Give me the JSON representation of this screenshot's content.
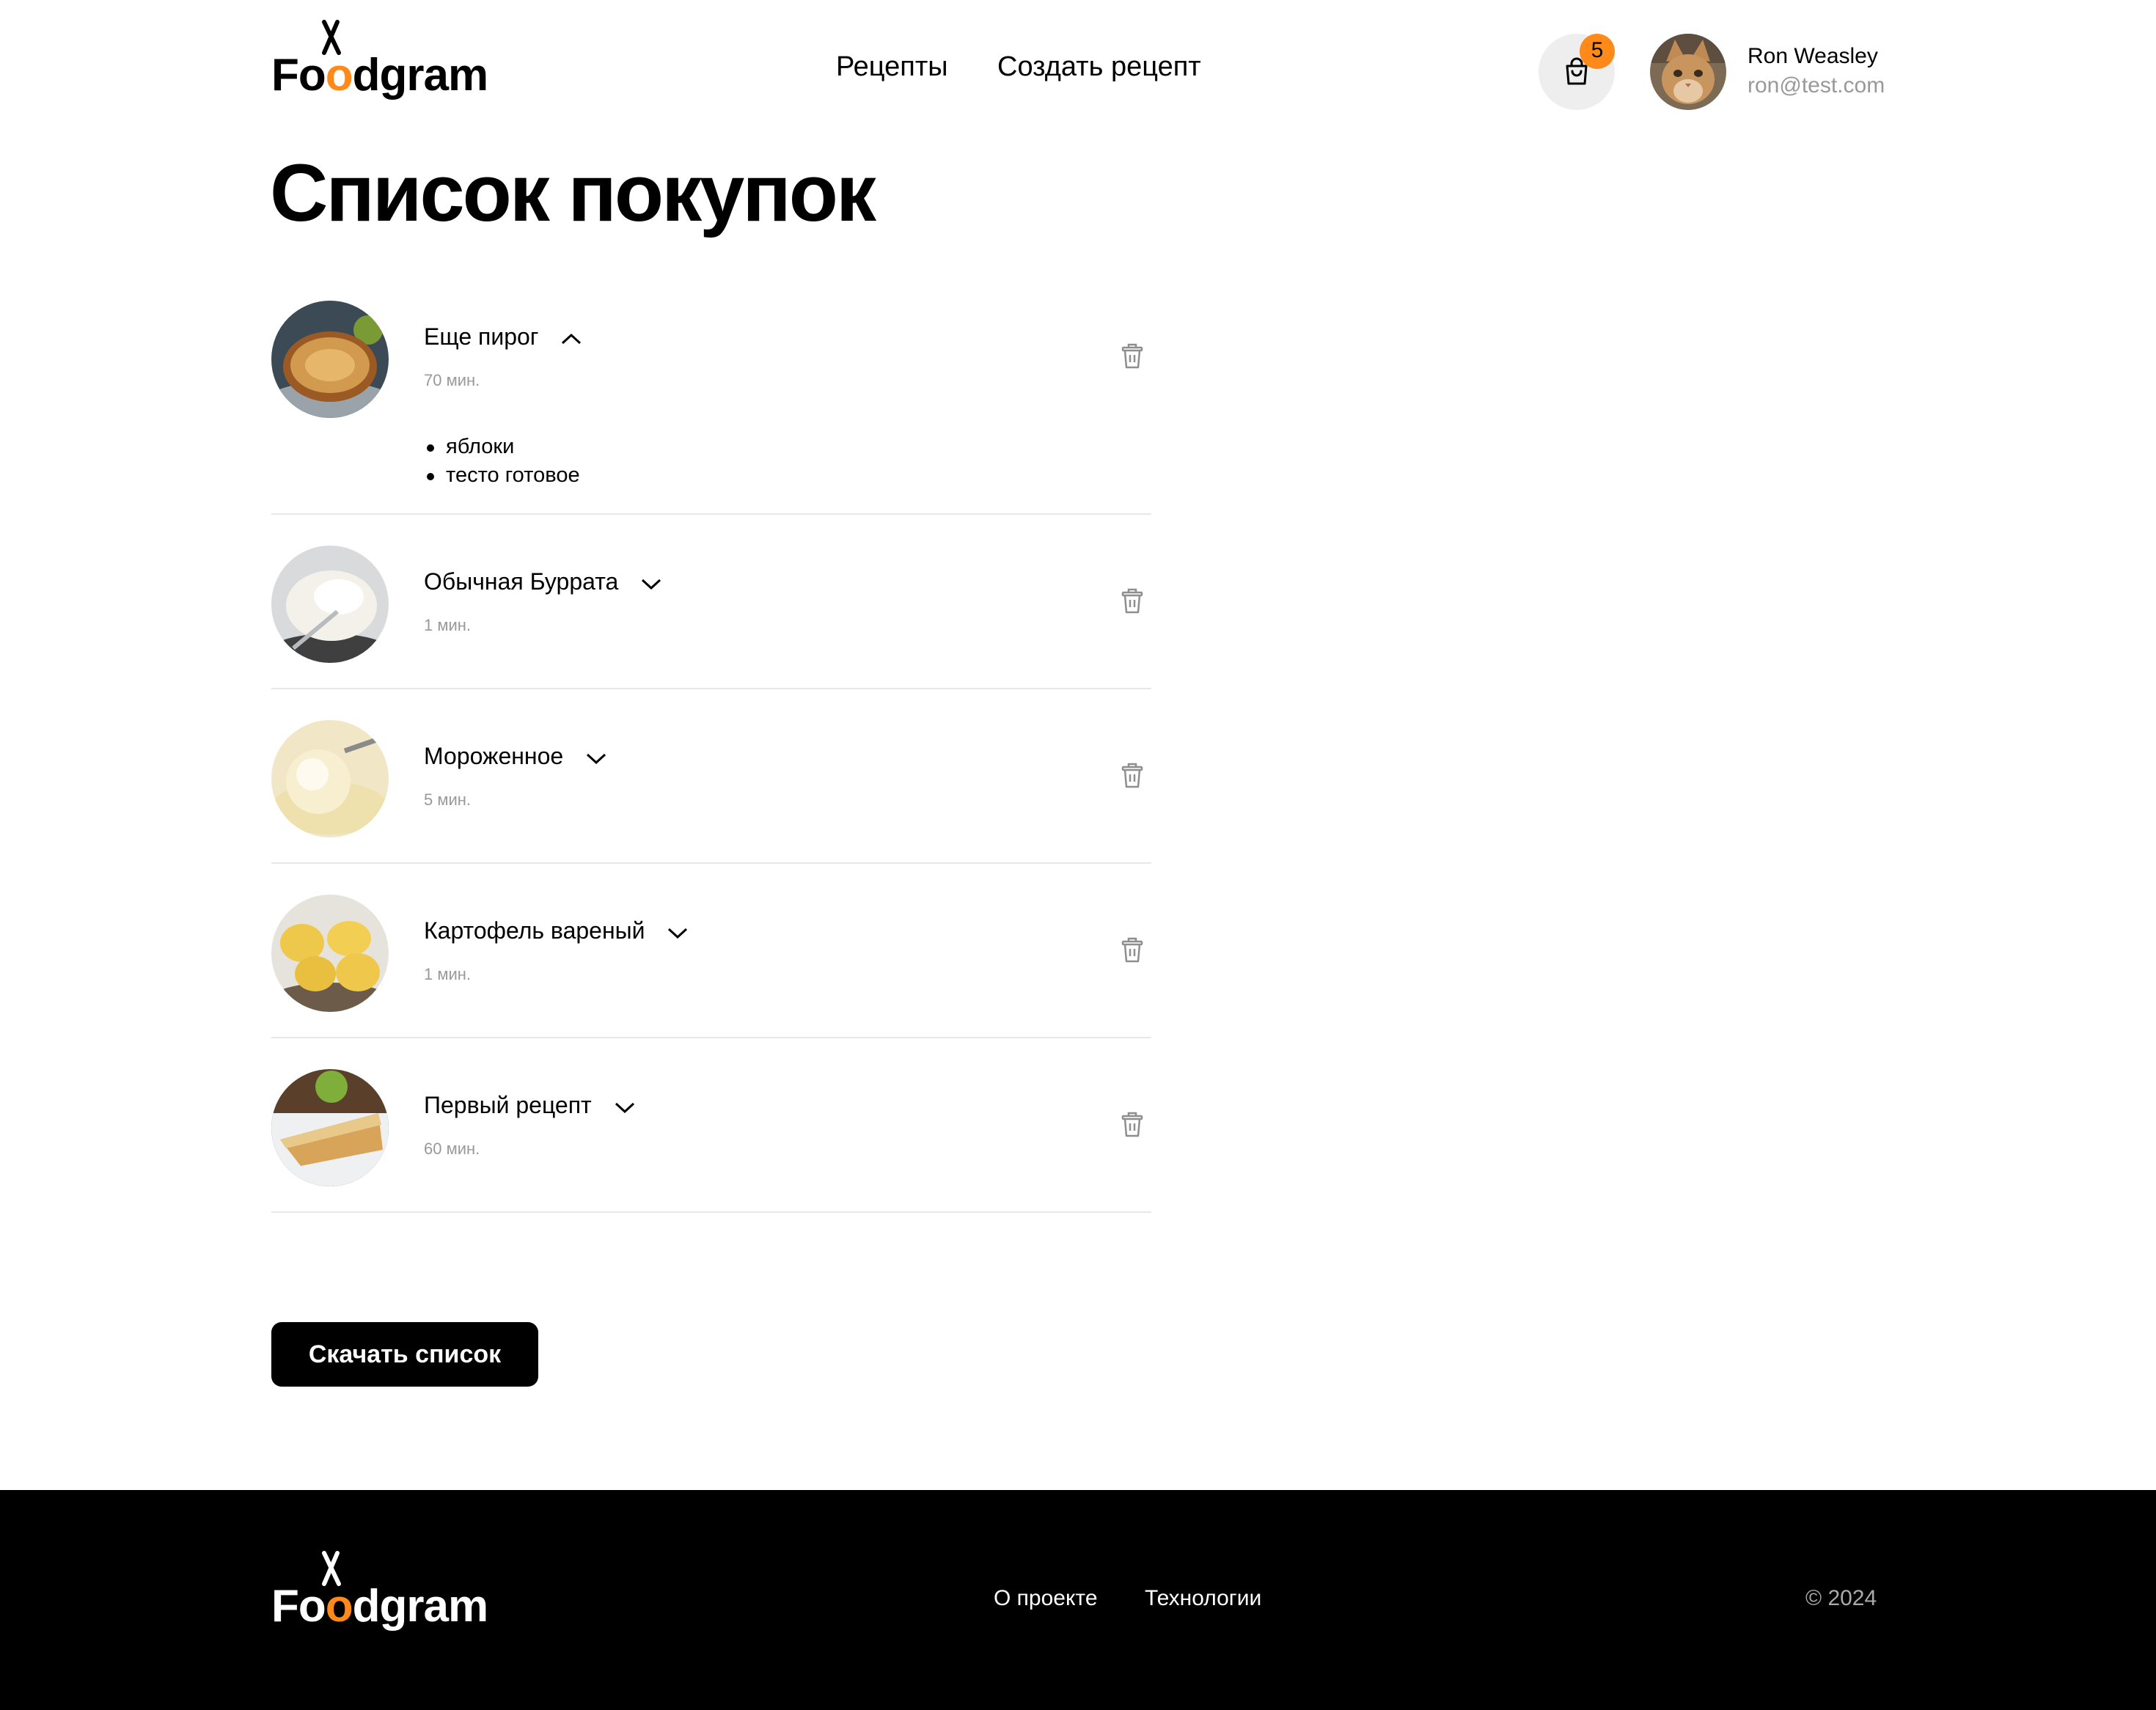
{
  "brand": {
    "name": "Foodgram",
    "accent": "#ff8a1a"
  },
  "nav": {
    "recipes": "Рецепты",
    "create_recipe": "Создать рецепт"
  },
  "cart": {
    "icon": "shopping-bag-icon",
    "count": "5"
  },
  "user": {
    "name": "Ron Weasley",
    "email": "ron@test.com"
  },
  "page_title": "Список покупок",
  "items": [
    {
      "name": "Еще пирог",
      "time": "70 мин.",
      "expanded": true,
      "ingredients": [
        "яблоки",
        "тесто готовое"
      ]
    },
    {
      "name": "Обычная Буррата",
      "time": "1 мин.",
      "expanded": false
    },
    {
      "name": "Мороженное",
      "time": "5 мин.",
      "expanded": false
    },
    {
      "name": "Картофель вареный",
      "time": "1 мин.",
      "expanded": false
    },
    {
      "name": "Первый рецепт",
      "time": "60 мин.",
      "expanded": false
    }
  ],
  "download_button": "Скачать список",
  "footer": {
    "about": "О проекте",
    "technologies": "Технологии",
    "copyright": "© 2024"
  }
}
